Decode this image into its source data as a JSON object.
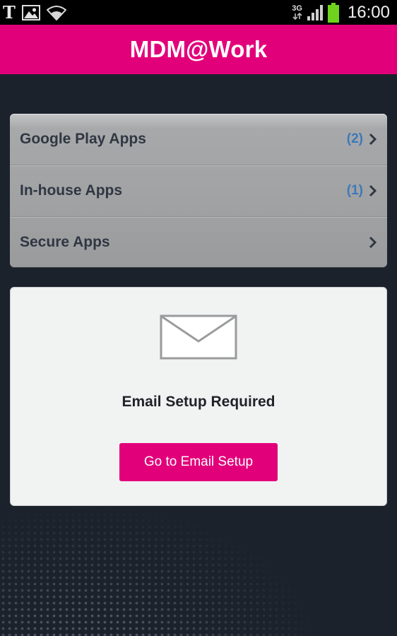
{
  "status_bar": {
    "network_type": "3G",
    "time": "16:00",
    "battery_color": "#6fd31e",
    "icons": [
      "t-mobile-logo-icon",
      "gallery-icon",
      "wifi-icon",
      "data-transfer-icon",
      "signal-icon",
      "battery-icon"
    ]
  },
  "header": {
    "title": "MDM@Work",
    "background": "#e2007a"
  },
  "menu": {
    "items": [
      {
        "label": "Google Play Apps",
        "count": "(2)"
      },
      {
        "label": "In-house Apps",
        "count": "(1)"
      },
      {
        "label": "Secure Apps",
        "count": ""
      }
    ],
    "count_color": "#3d79b8"
  },
  "email_card": {
    "icon": "envelope-icon",
    "title": "Email Setup Required",
    "button_label": "Go to Email Setup"
  }
}
